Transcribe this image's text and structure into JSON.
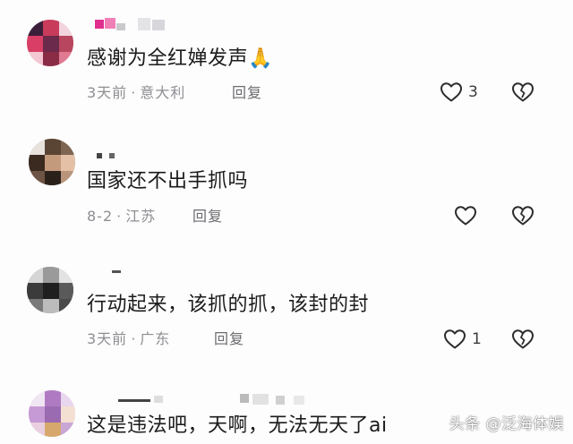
{
  "comments": [
    {
      "text": "感谢为全红婵发声🙏",
      "time": "3天前",
      "location": "意大利",
      "reply_label": "回复",
      "like_count": "3"
    },
    {
      "text": "国家还不出手抓吗",
      "time": "8-2",
      "location": "江苏",
      "reply_label": "回复",
      "like_count": ""
    },
    {
      "text": "行动起来，该抓的抓，该封的封",
      "time": "3天前",
      "location": "广东",
      "reply_label": "回复",
      "like_count": "1"
    },
    {
      "text": "这是违法吧，天啊，无法无天了ai",
      "time": "",
      "location": "",
      "reply_label": "",
      "like_count": ""
    }
  ],
  "watermark": "头条 @泛海体娱",
  "icons": {
    "like": "heart-outline-icon",
    "dislike": "broken-heart-icon"
  },
  "colors": {
    "text": "#1b1b1b",
    "meta": "#8e8e93",
    "icon": "#2c2c2e"
  }
}
